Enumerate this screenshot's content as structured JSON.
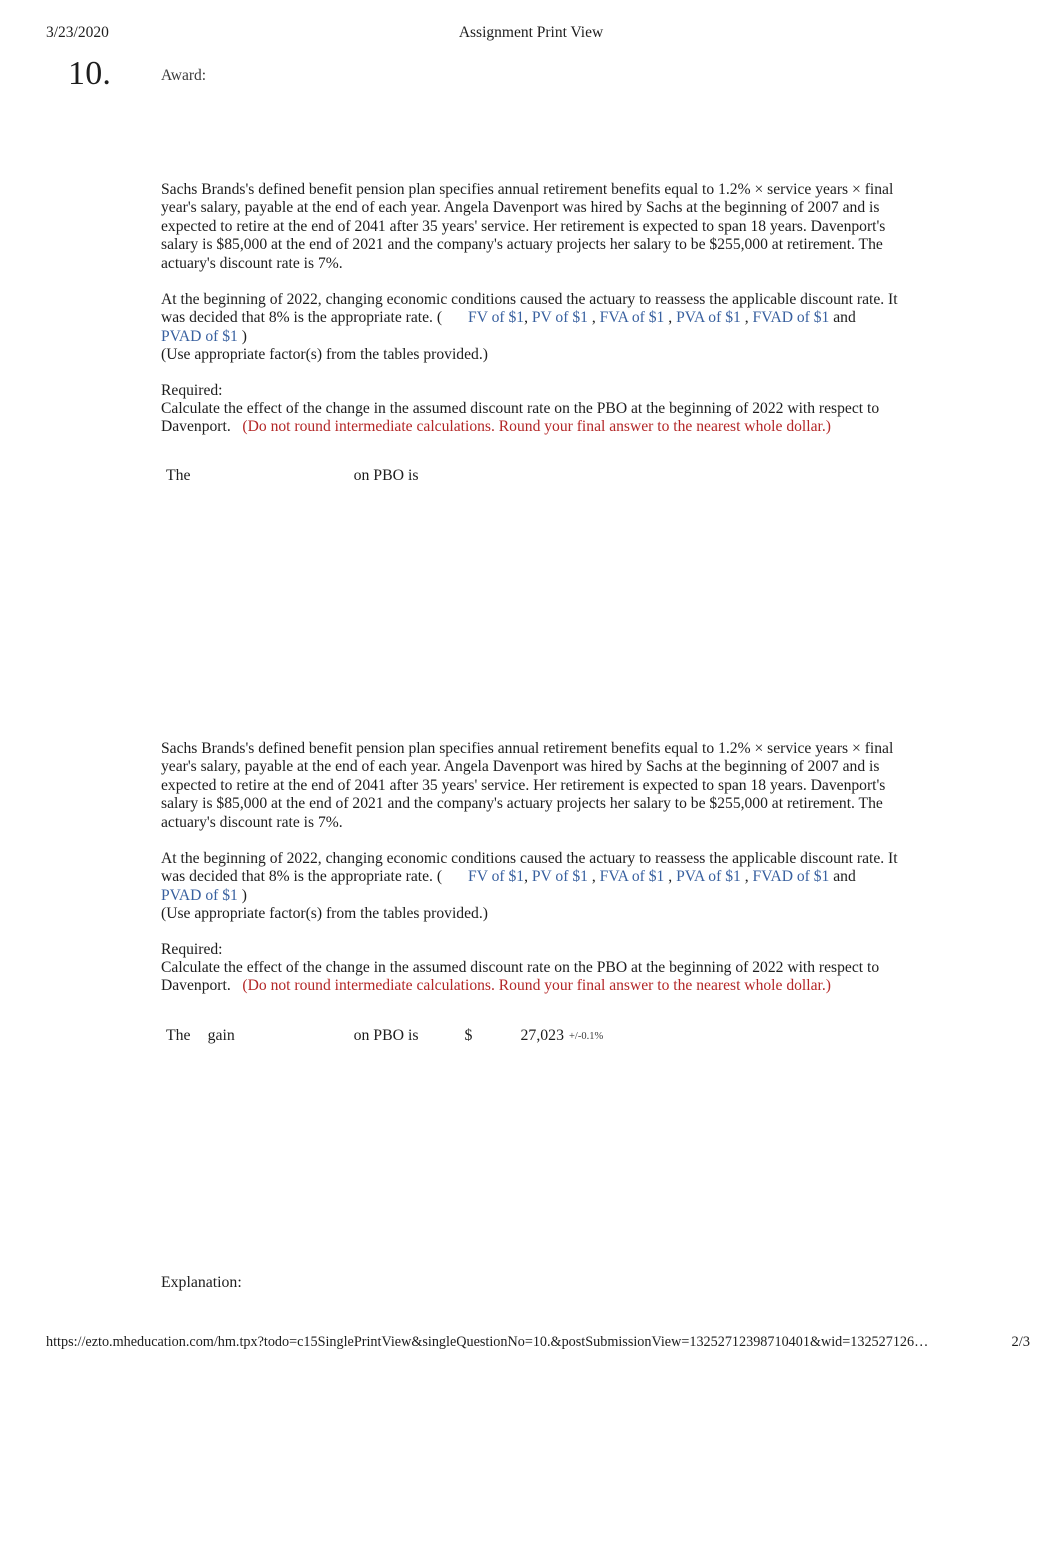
{
  "header": {
    "date": "3/23/2020",
    "title": "Assignment Print View"
  },
  "question": {
    "number": "10.",
    "award_label": "Award:"
  },
  "content": {
    "paragraph1": "Sachs Brands's defined benefit pension plan specifies annual retirement benefits equal to 1.2% × service years × final year's salary, payable at the end of each year. Angela Davenport was hired by Sachs at the beginning of 2007 and is expected to retire at the end of 2041 after 35 years' service. Her retirement is expected to span 18 years. Davenport's salary is $85,000 at the end of 2021 and the company's actuary projects her salary to be $255,000 at retirement. The actuary's discount rate is 7%.",
    "paragraph2_lead": "At the beginning of 2022, changing economic conditions caused the actuary to reassess the applicable discount rate. It was decided that 8% is the appropriate rate. (",
    "paragraph2_close": ")",
    "factor_links": [
      "FV of $1",
      "PV of $1",
      "FVA of $1",
      "PVA of $1",
      "FVAD of $1",
      "PVAD of $1"
    ],
    "link_separator": ",",
    "link_conjunction": "and",
    "use_factors_note": "(Use appropriate factor(s) from the tables provided.)",
    "required_label": "Required:",
    "required_text": "Calculate the effect of the change in the assumed discount rate on the PBO at the beginning of 2022 with respect to Davenport.",
    "rounding_note": "(Do not round intermediate calculations. Round your final answer to the nearest whole dollar.)",
    "explanation_label": "Explanation:"
  },
  "answer_blank": {
    "prefix": "The",
    "effect_word": "",
    "middle": "on PBO is",
    "currency": "",
    "value": "",
    "tolerance": ""
  },
  "answer_filled": {
    "prefix": "The",
    "effect_word": "gain",
    "middle": "on PBO is",
    "currency": "$",
    "value": "27,023",
    "tolerance": "+/-0.1%"
  },
  "footer": {
    "url": "https://ezto.mheducation.com/hm.tpx?todo=c15SinglePrintView&singleQuestionNo=10.&postSubmissionView=13252712398710401&wid=132527126…",
    "page": "2/3"
  },
  "colors": {
    "link": "#38609f",
    "note": "#b32626",
    "text": "#1d1d1d"
  }
}
